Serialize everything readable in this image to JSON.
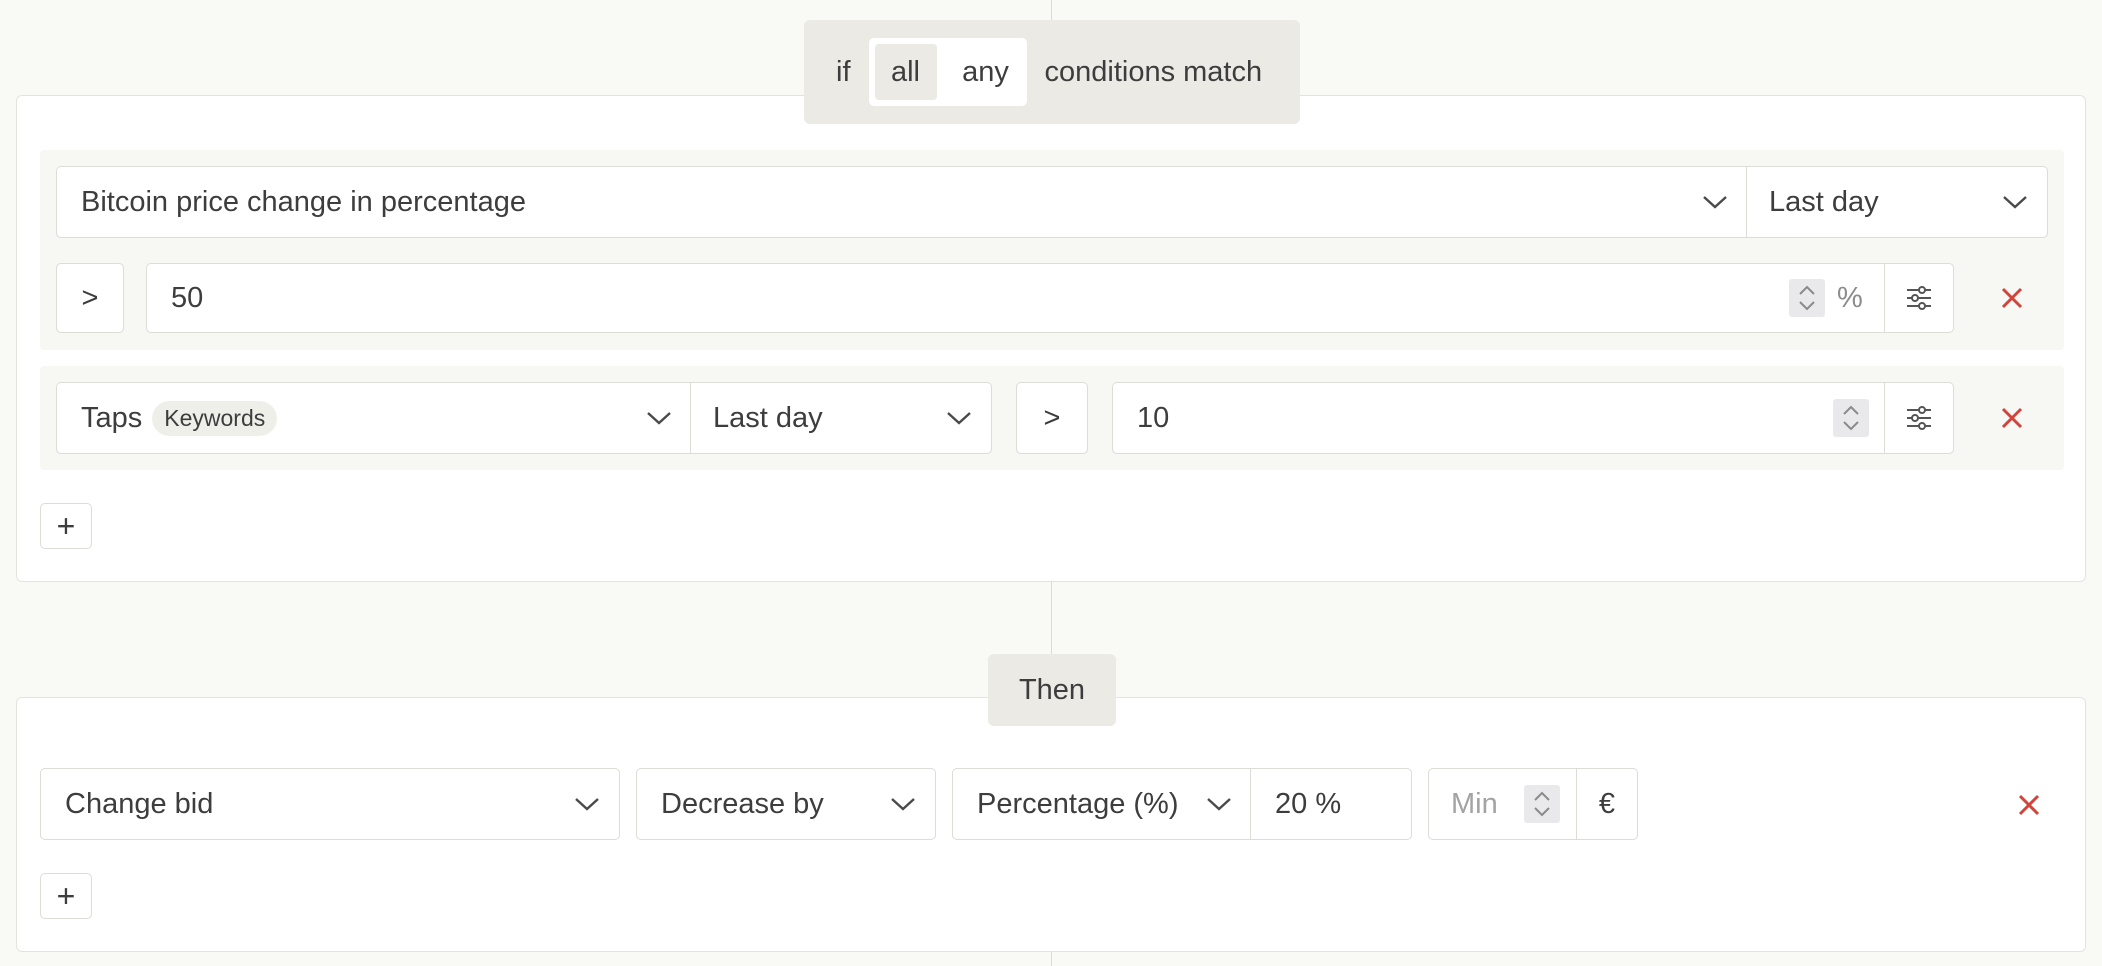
{
  "condition_header": {
    "prefix": "if",
    "options": [
      "all",
      "any"
    ],
    "selected": "all",
    "suffix": "conditions match"
  },
  "conditions": [
    {
      "metric": "Bitcoin price change in percentage",
      "period": "Last day",
      "operator": ">",
      "value": "50",
      "unit": "%"
    },
    {
      "metric": "Taps",
      "metric_tag": "Keywords",
      "period": "Last day",
      "operator": ">",
      "value": "10"
    }
  ],
  "add_condition_label": "+",
  "then_label": "Then",
  "action": {
    "type": "Change bid",
    "direction": "Decrease by",
    "mode": "Percentage (%)",
    "amount": "20 %",
    "min_placeholder": "Min",
    "currency": "€"
  },
  "add_action_label": "+",
  "colors": {
    "remove_red": "#d0453b",
    "accent_bg": "#ebeae5"
  }
}
